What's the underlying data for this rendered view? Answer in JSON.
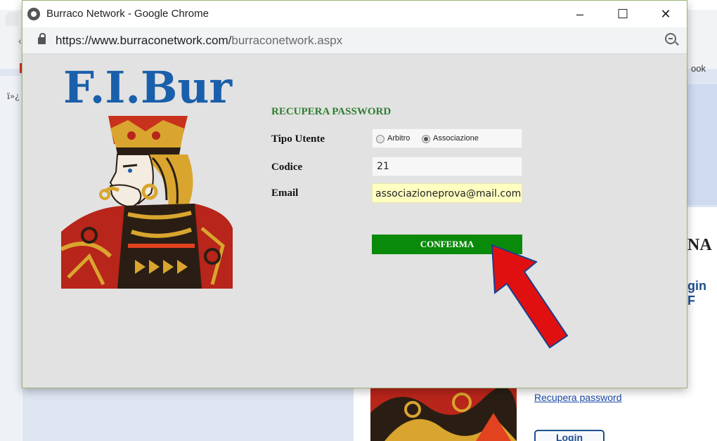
{
  "background_page": {
    "bookmark_text": "ook",
    "garbled_text": "ï»¿",
    "title_fragment": "NA",
    "subtitle_fragment": "gin F",
    "recupera_link": "Recupera password",
    "login_button": "Login",
    "nav_arrow": "‹"
  },
  "window": {
    "title": "Burraco Network - Google Chrome",
    "minimize_glyph": "–",
    "maximize_glyph": "☐",
    "close_glyph": "✕"
  },
  "address_bar": {
    "url_host": "https://www.burraconetwork.com/",
    "url_path": "burraconetwork.aspx"
  },
  "logo": {
    "text": "F.I.Bur"
  },
  "form": {
    "heading": "RECUPERA PASSWORD",
    "tipo_utente_label": "Tipo Utente",
    "radio_options": [
      {
        "label": "Arbitro",
        "selected": false
      },
      {
        "label": "Associazione",
        "selected": true
      }
    ],
    "codice_label": "Codice",
    "codice_value": "21",
    "email_label": "Email",
    "email_value": "associazioneprova@mail.com",
    "confirm_button": "CONFERMA"
  },
  "annotation": {
    "arrow_color": "#e01010"
  },
  "colors": {
    "heading_green": "#2f7d2f",
    "button_green": "#0a8a0a",
    "logo_blue": "#1a5fab",
    "email_highlight": "#ffffc2"
  }
}
